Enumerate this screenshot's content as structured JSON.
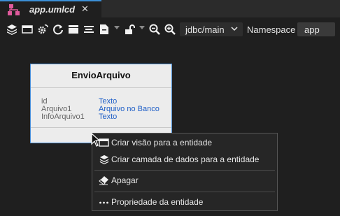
{
  "tab": {
    "title": "app.umlcd",
    "close": "✕",
    "icon": "uml-diagram-icon"
  },
  "toolbar": {
    "icons": [
      "layers-icon",
      "window-icon",
      "gear-refresh-icon",
      "refresh-icon",
      "panel-icon",
      "list-icon",
      "document-icon",
      "caret-down-icon",
      "unlock-icon",
      "caret-down-icon",
      "zoom-out-icon",
      "zoom-in-icon"
    ],
    "schema_value": "jdbc/main",
    "namespace_label": "Namespace",
    "namespace_value": "app"
  },
  "entity": {
    "title": "EnvioArquivo",
    "attributes": [
      {
        "name": "id",
        "type": "Texto"
      },
      {
        "name": "Arquivo1",
        "type": "Arquivo no Banco"
      },
      {
        "name": "InfoArquivo1",
        "type": "Texto"
      }
    ]
  },
  "context_menu": {
    "items": [
      {
        "label": "Criar visão para a entidade",
        "icon": "window-icon"
      },
      {
        "label": "Criar camada de dados para a entidade",
        "icon": "layers-icon"
      },
      {
        "label": "Apagar",
        "icon": "eraser-icon"
      },
      {
        "label": "Propriedade da entidade",
        "icon": "ellipsis-icon"
      }
    ]
  },
  "colors": {
    "background": "#1f1f1f",
    "accent": "#3c8fd6",
    "link": "#1f5fc7",
    "entity_bg": "#ececec"
  }
}
